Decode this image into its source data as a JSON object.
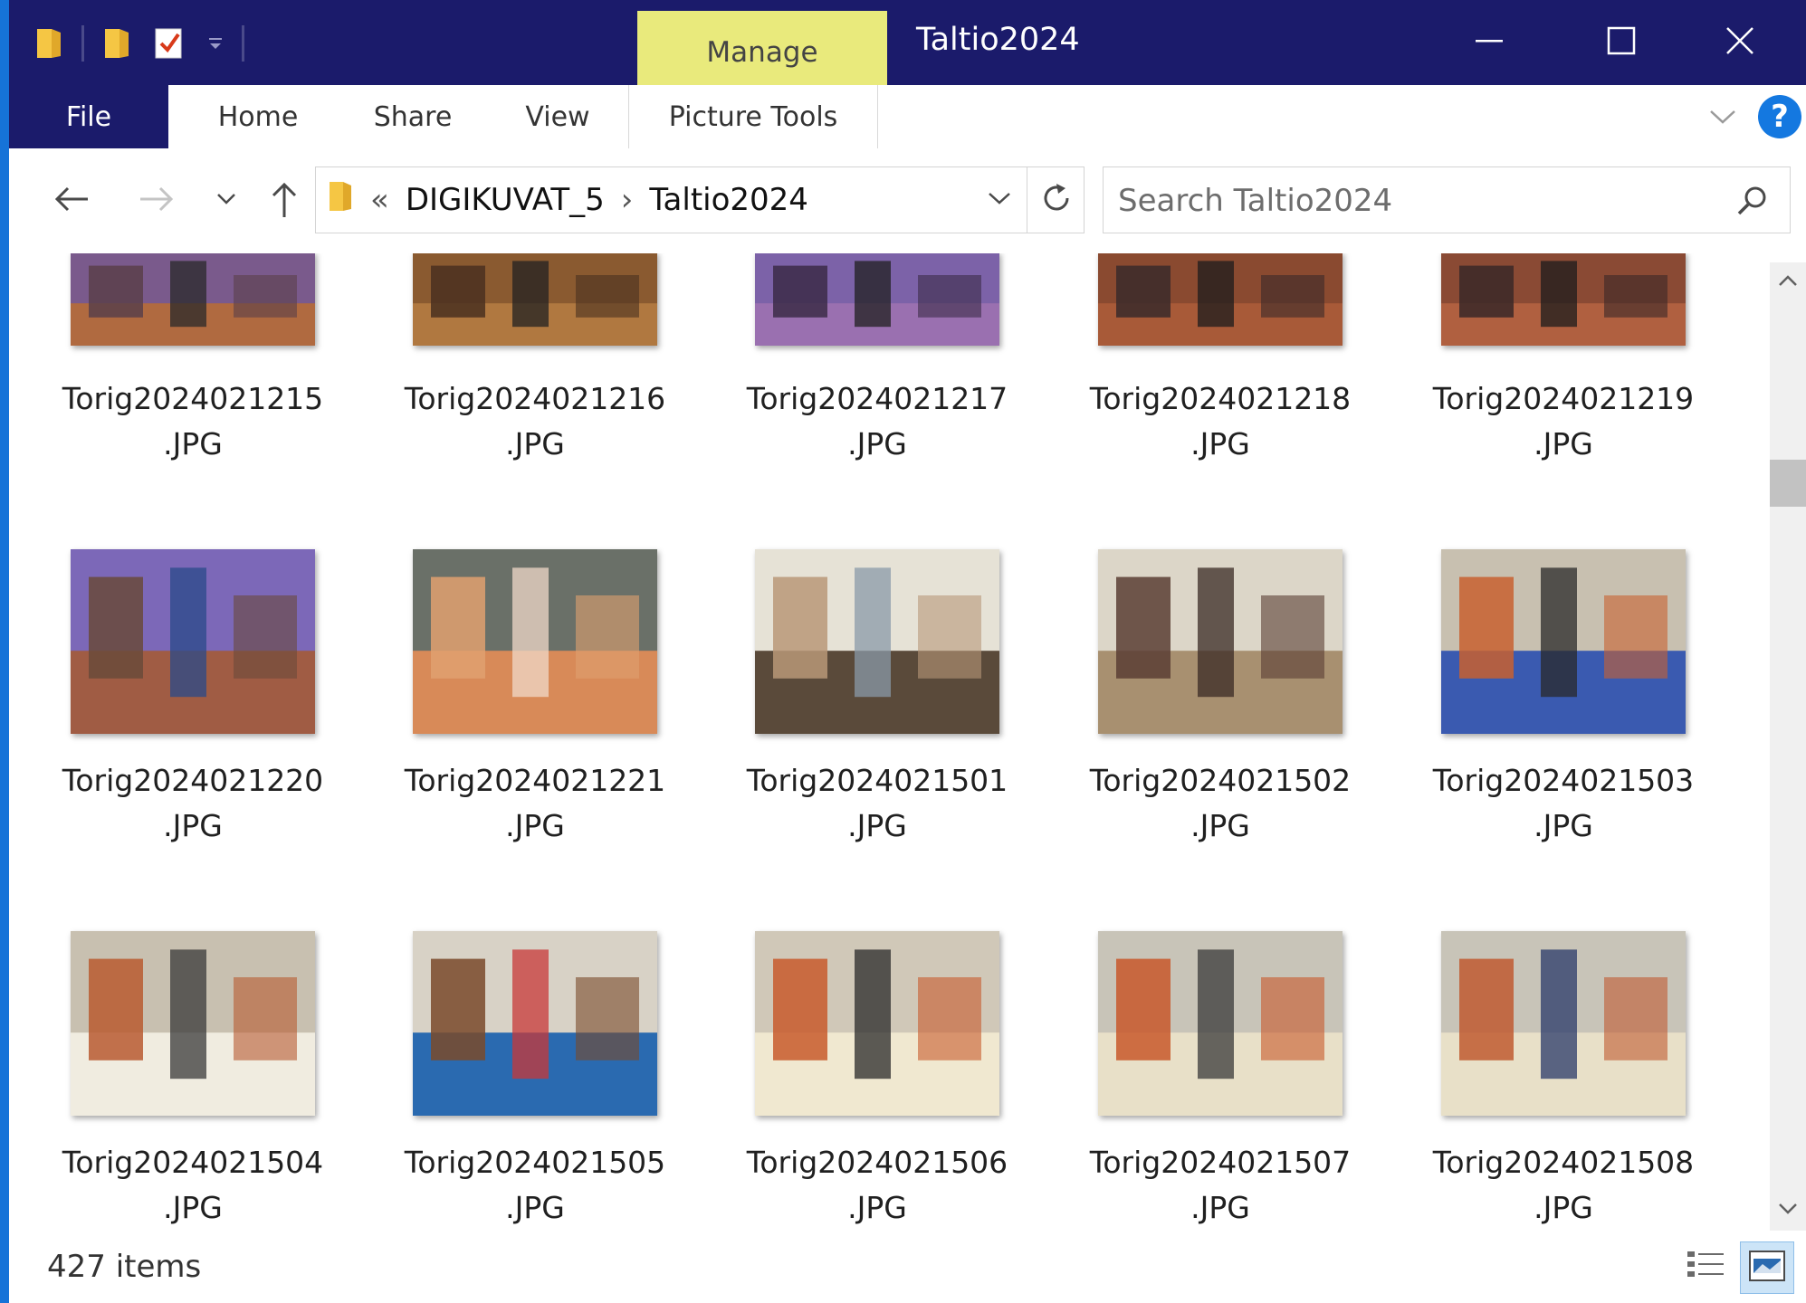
{
  "window": {
    "title": "Taltio2024",
    "contextual_tab": "Manage",
    "controls": [
      "minimize-icon",
      "maximize-icon",
      "close-icon"
    ]
  },
  "quick_access": {
    "icons": [
      "folder-icon",
      "new-folder-icon",
      "properties-checkbox-icon",
      "customize-dropdown-icon"
    ]
  },
  "ribbon": {
    "tabs": [
      {
        "name": "file",
        "label": "File"
      },
      {
        "name": "home",
        "label": "Home"
      },
      {
        "name": "share",
        "label": "Share"
      },
      {
        "name": "view",
        "label": "View"
      },
      {
        "name": "picture-tools",
        "label": "Picture Tools"
      }
    ],
    "help_label": "?"
  },
  "navigation": {
    "overflow_marker": "«",
    "breadcrumb": [
      "DIGIKUVAT_5",
      "Taltio2024"
    ],
    "separator": "›"
  },
  "search": {
    "placeholder": "Search Taltio2024",
    "value": ""
  },
  "files": [
    {
      "line1": "Torig2024021215",
      "line2": ".JPG",
      "palette": [
        "#7a5a8c",
        "#5a3f4a",
        "#b06a40",
        "#2a2a2a"
      ]
    },
    {
      "line1": "Torig2024021216",
      "line2": ".JPG",
      "palette": [
        "#8a5a30",
        "#4a3020",
        "#b07840",
        "#222222"
      ]
    },
    {
      "line1": "Torig2024021217",
      "line2": ".JPG",
      "palette": [
        "#7c62a8",
        "#3c2c48",
        "#9a70b0",
        "#202020"
      ]
    },
    {
      "line1": "Torig2024021218",
      "line2": ".JPG",
      "palette": [
        "#8a4a30",
        "#3a2a2a",
        "#a85a38",
        "#1c1c1c"
      ]
    },
    {
      "line1": "Torig2024021219",
      "line2": ".JPG",
      "palette": [
        "#8a4a34",
        "#3a2828",
        "#b06040",
        "#1c1c1c"
      ]
    },
    {
      "line1": "Torig2024021220",
      "line2": ".JPG",
      "palette": [
        "#7c68b8",
        "#6a4a3a",
        "#a05c44",
        "#2a4a8a"
      ]
    },
    {
      "line1": "Torig2024021221",
      "line2": ".JPG",
      "palette": [
        "#6a7068",
        "#e0a070",
        "#d88a58",
        "#f0d8c8"
      ]
    },
    {
      "line1": "Torig2024021501",
      "line2": ".JPG",
      "palette": [
        "#e6e2d6",
        "#b89878",
        "#5a4a3a",
        "#8a9aa8"
      ]
    },
    {
      "line1": "Torig2024021502",
      "line2": ".JPG",
      "palette": [
        "#dcd6c8",
        "#5a3e34",
        "#a89070",
        "#3a2a24"
      ]
    },
    {
      "line1": "Torig2024021503",
      "line2": ".JPG",
      "palette": [
        "#c8c0b0",
        "#c86030",
        "#3a5ab0",
        "#2a2a2a"
      ]
    },
    {
      "line1": "Torig2024021504",
      "line2": ".JPG",
      "palette": [
        "#c8c0b0",
        "#b85a30",
        "#f0ece0",
        "#3a3a3a"
      ]
    },
    {
      "line1": "Torig2024021505",
      "line2": ".JPG",
      "palette": [
        "#d8d2c6",
        "#7a4a2a",
        "#2a6ab0",
        "#c83838"
      ]
    },
    {
      "line1": "Torig2024021506",
      "line2": ".JPG",
      "palette": [
        "#d0c8b8",
        "#c85a2c",
        "#f0e8d0",
        "#2a2a2a"
      ]
    },
    {
      "line1": "Torig2024021507",
      "line2": ".JPG",
      "palette": [
        "#c8c4b8",
        "#c8582a",
        "#e8e0c8",
        "#3a3a3a"
      ]
    },
    {
      "line1": "Torig2024021508",
      "line2": ".JPG",
      "palette": [
        "#c8c4b8",
        "#c05a30",
        "#e8e0c8",
        "#2a3a6a"
      ]
    }
  ],
  "status": {
    "item_count": "427 items"
  },
  "colors": {
    "titlebar": "#1b1b6b",
    "contextual_tab": "#e9ea7c",
    "accent": "#1673d8",
    "help": "#1478e0"
  }
}
